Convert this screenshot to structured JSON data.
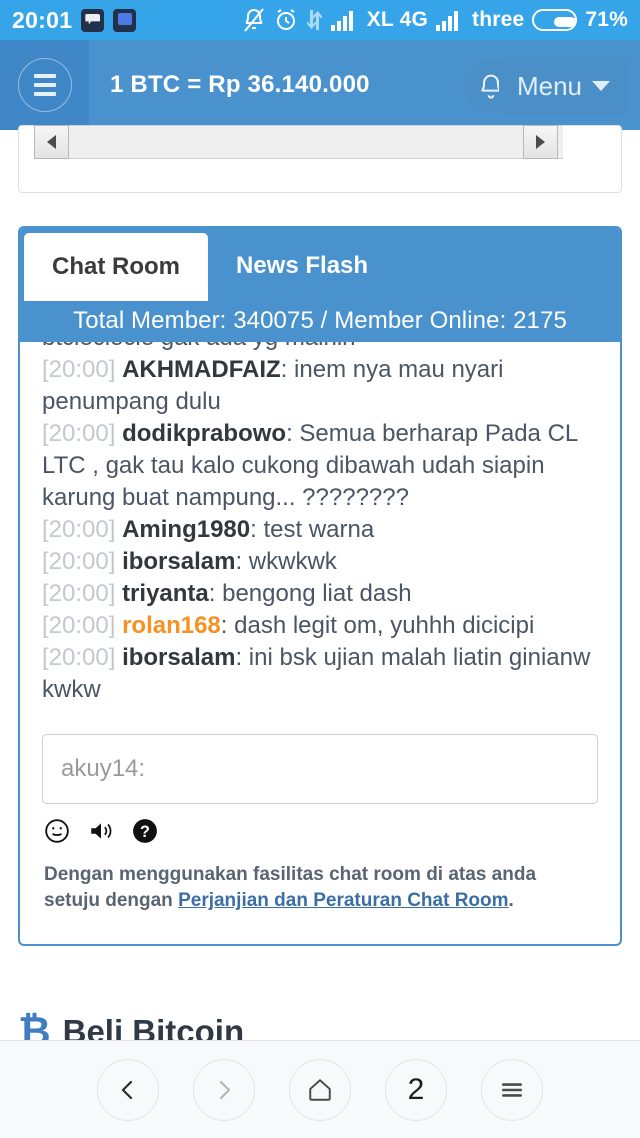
{
  "status_bar": {
    "clock": "20:01",
    "app_icons": [
      "message-app-icon",
      "chat-app-icon"
    ],
    "icons": [
      "bell-off-icon",
      "alarm-clock-icon",
      "data-transfer-icon",
      "signal-bars-icon",
      "signal-bars-icon"
    ],
    "carrier_1": "XL 4G",
    "carrier_2": "three",
    "battery_percent": "71%"
  },
  "header": {
    "menu_icon": "hamburger-icon",
    "title": "1 BTC = Rp 36.140.000",
    "bell_icon": "bell-icon",
    "menu_label": "Menu",
    "caret_icon": "chevron-down-icon"
  },
  "carousel": {
    "left_arrow": "arrow-left-icon",
    "right_arrow": "arrow-right-icon"
  },
  "chat": {
    "tabs": [
      {
        "label": "Chat Room",
        "active": true
      },
      {
        "label": "News Flash",
        "active": false
      }
    ],
    "member_bar": "Total Member: 340075 / Member Online: 2175",
    "messages": [
      {
        "time": "",
        "nick": "",
        "nick_color": "",
        "text": "btcleclecle gak ada yg mainin",
        "partial": true
      },
      {
        "time": "[20:00]",
        "nick": "AKHMADFAIZ",
        "nick_color": "#33383d",
        "text": ": inem nya mau nyari penumpang dulu"
      },
      {
        "time": "[20:00]",
        "nick": "dodikprabowo",
        "nick_color": "#33383d",
        "text": ": Semua berharap Pada CL LTC , gak tau kalo cukong dibawah udah siapin karung buat nampung... ????????"
      },
      {
        "time": "[20:00]",
        "nick": "Aming1980",
        "nick_color": "#33383d",
        "text": ": test warna"
      },
      {
        "time": "[20:00]",
        "nick": "iborsalam",
        "nick_color": "#33383d",
        "text": ": wkwkwk"
      },
      {
        "time": "[20:00]",
        "nick": "triyanta",
        "nick_color": "#33383d",
        "text": ": bengong liat dash"
      },
      {
        "time": "[20:00]",
        "nick": "rolan168",
        "nick_color": "#f79122",
        "text": ": dash legit om, yuhhh dicicipi"
      },
      {
        "time": "[20:00]",
        "nick": "iborsalam",
        "nick_color": "#33383d",
        "text": ": ini bsk ujian malah liatin ginianw kwkw"
      }
    ],
    "input": {
      "value": "",
      "placeholder": "akuy14:"
    },
    "tool_icons": [
      "emoji-icon",
      "sound-icon",
      "help-icon"
    ],
    "disclaimer_pre": "Dengan menggunakan fasilitas chat room di atas anda setuju dengan ",
    "disclaimer_link": "Perjanjian dan Peraturan Chat Room",
    "disclaimer_post": "."
  },
  "beli_bitcoin": {
    "symbol": "₿",
    "label": "Beli Bitcoin"
  },
  "bottom_nav": {
    "back_icon": "chevron-left-icon",
    "forward_icon": "chevron-right-icon",
    "home_icon": "home-icon",
    "tab_count": "2",
    "menu_icon": "hamburger-icon"
  },
  "colors": {
    "status_bar_bg": "#35a4e8",
    "header_bg": "#4a92ce",
    "accent": "#4a92ce",
    "nick_highlight": "#f79122"
  }
}
